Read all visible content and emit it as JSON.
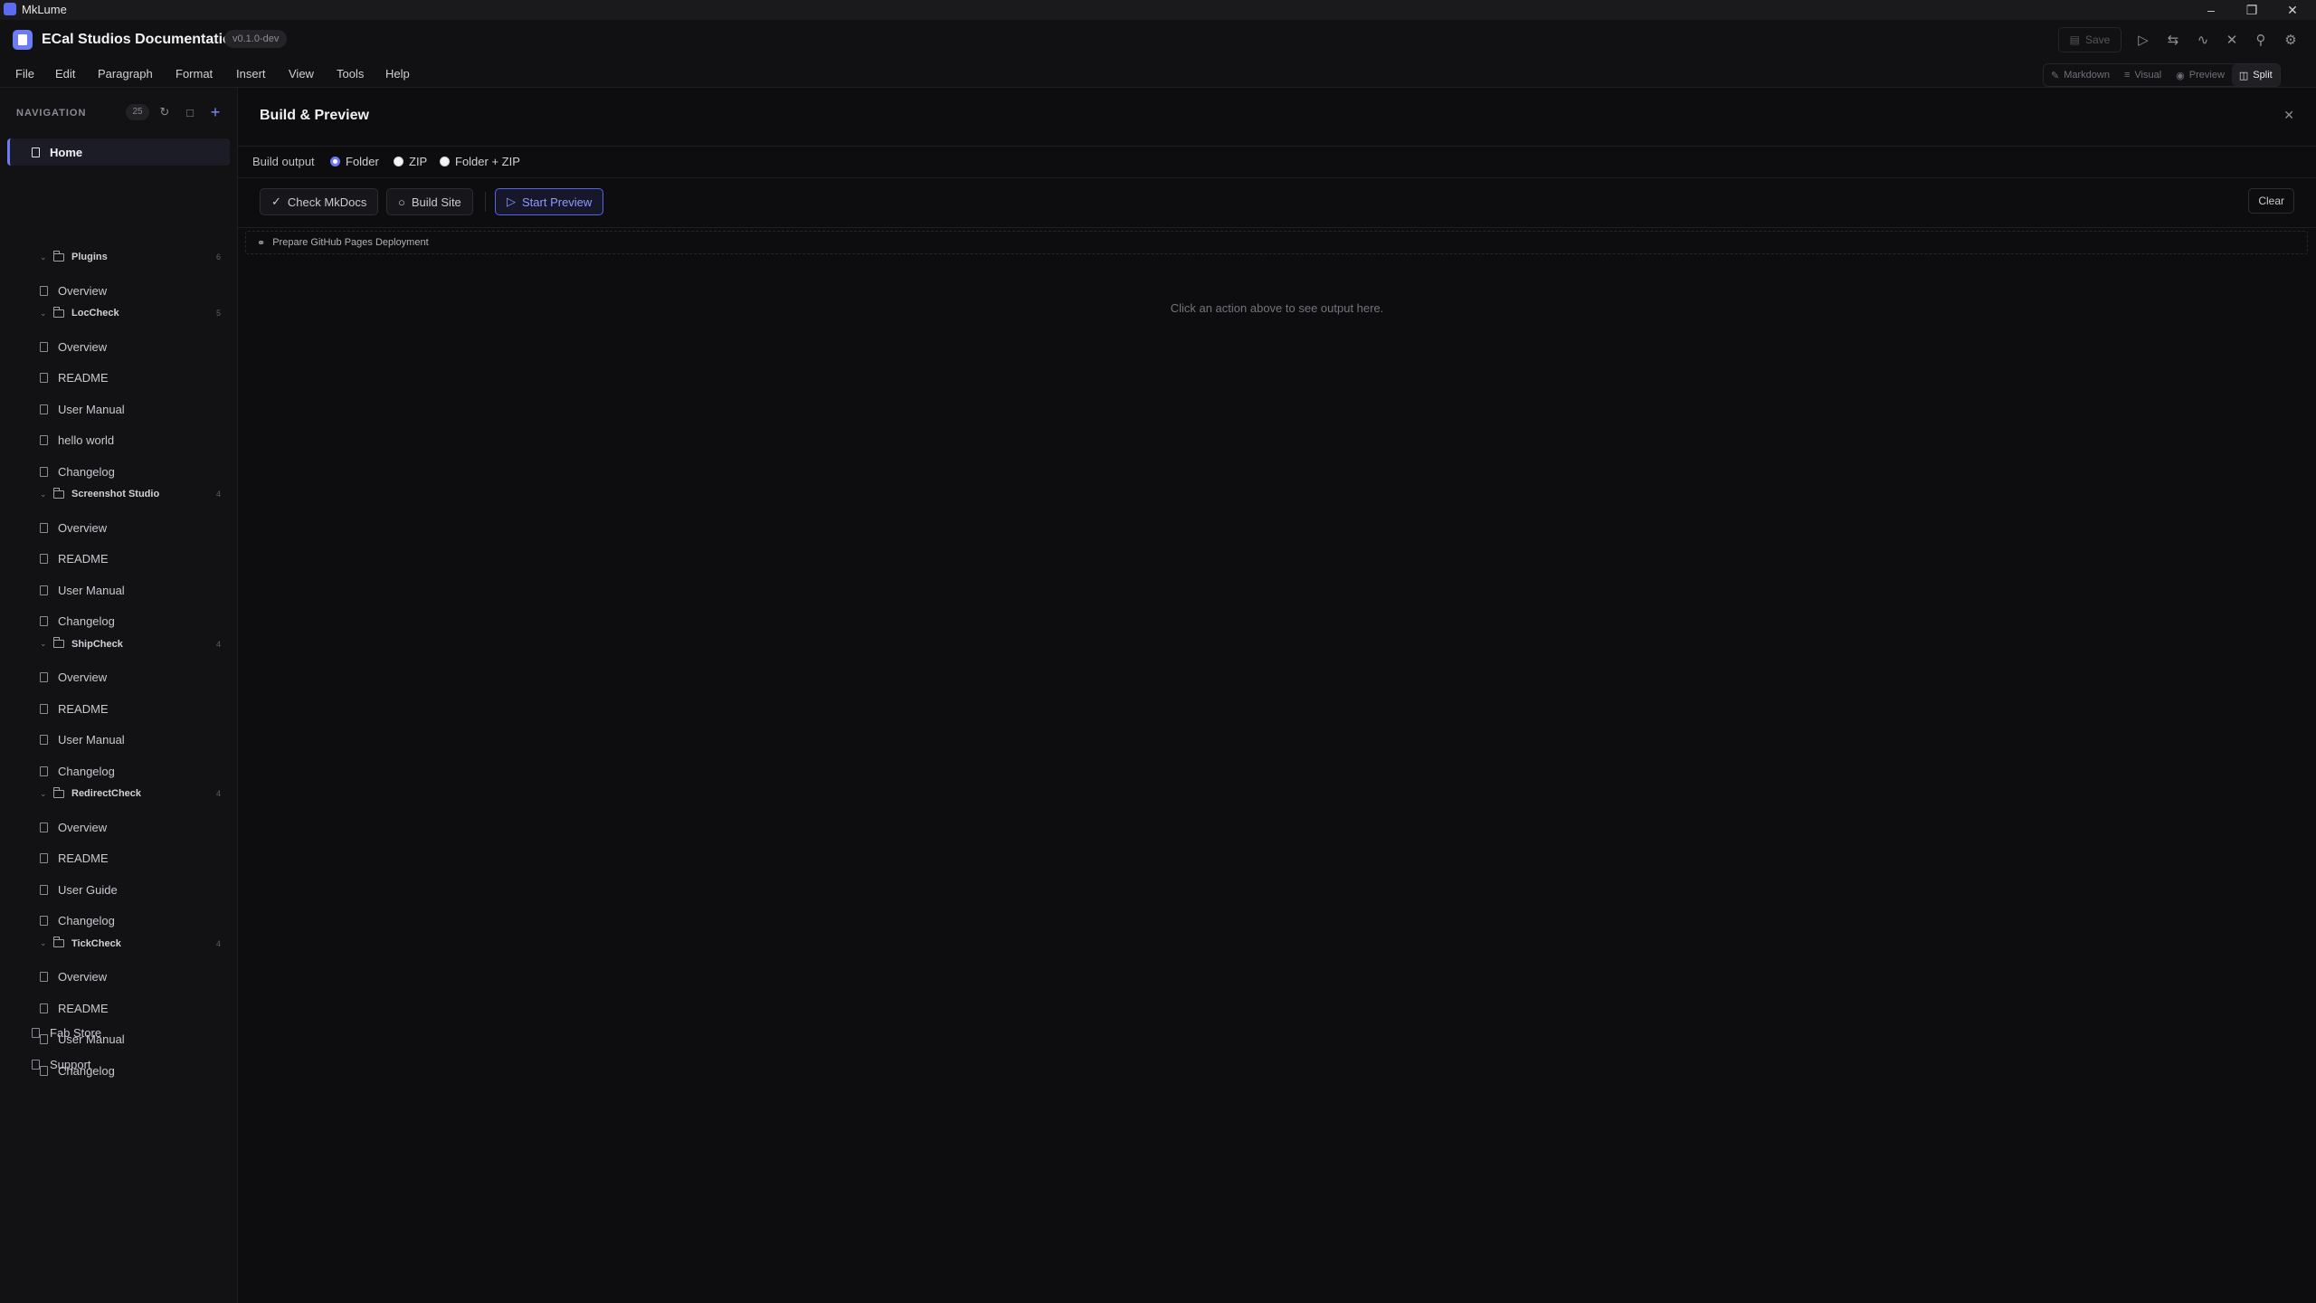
{
  "os": {
    "title": "MkLume"
  },
  "header": {
    "title": "ECal Studios Documentation",
    "version": "v0.1.0-dev",
    "save_label": "Save"
  },
  "menu": [
    "File",
    "Edit",
    "Paragraph",
    "Format",
    "Insert",
    "View",
    "Tools",
    "Help"
  ],
  "modes": [
    {
      "label": "Markdown",
      "icon": "pencil-icon",
      "active": false
    },
    {
      "label": "Visual",
      "icon": "visual-icon",
      "active": false
    },
    {
      "label": "Preview",
      "icon": "eye-icon",
      "active": false
    },
    {
      "label": "Split",
      "icon": "split-icon",
      "active": true
    }
  ],
  "sidebar": {
    "heading": "NAVIGATION",
    "count": "25",
    "home": "Home",
    "tree": [
      {
        "type": "folder",
        "label": "Plugins",
        "count": "6"
      },
      {
        "type": "page",
        "label": "Overview"
      },
      {
        "type": "folder",
        "label": "LocCheck",
        "count": "5"
      },
      {
        "type": "page",
        "label": "Overview"
      },
      {
        "type": "page",
        "label": "README"
      },
      {
        "type": "page",
        "label": "User Manual"
      },
      {
        "type": "page",
        "label": "hello world"
      },
      {
        "type": "page",
        "label": "Changelog"
      },
      {
        "type": "folder",
        "label": "Screenshot Studio",
        "count": "4"
      },
      {
        "type": "page",
        "label": "Overview"
      },
      {
        "type": "page",
        "label": "README"
      },
      {
        "type": "page",
        "label": "User Manual"
      },
      {
        "type": "page",
        "label": "Changelog"
      },
      {
        "type": "folder",
        "label": "ShipCheck",
        "count": "4"
      },
      {
        "type": "page",
        "label": "Overview"
      },
      {
        "type": "page",
        "label": "README"
      },
      {
        "type": "page",
        "label": "User Manual"
      },
      {
        "type": "page",
        "label": "Changelog"
      },
      {
        "type": "folder",
        "label": "RedirectCheck",
        "count": "4"
      },
      {
        "type": "page",
        "label": "Overview"
      },
      {
        "type": "page",
        "label": "README"
      },
      {
        "type": "page",
        "label": "User Guide"
      },
      {
        "type": "page",
        "label": "Changelog"
      },
      {
        "type": "folder",
        "label": "TickCheck",
        "count": "4"
      },
      {
        "type": "page",
        "label": "Overview"
      },
      {
        "type": "page",
        "label": "README"
      },
      {
        "type": "page",
        "label": "User Manual"
      },
      {
        "type": "page",
        "label": "Changelog"
      }
    ],
    "bottom": [
      "Fab Store",
      "Support"
    ]
  },
  "panel": {
    "title": "Build & Preview",
    "build_output_label": "Build output",
    "options": [
      {
        "label": "Folder",
        "selected": true
      },
      {
        "label": "ZIP",
        "selected": false
      },
      {
        "label": "Folder + ZIP",
        "selected": false
      }
    ],
    "actions": {
      "check": "Check MkDocs",
      "build": "Build Site",
      "preview": "Start Preview",
      "clear": "Clear"
    },
    "gh_pages": "Prepare GitHub Pages Deployment",
    "hint": "Click an action above to see output here."
  },
  "colors": {
    "accent": "#6d7cf5",
    "background": "#0d0d0f",
    "sidebar": "#121215"
  }
}
